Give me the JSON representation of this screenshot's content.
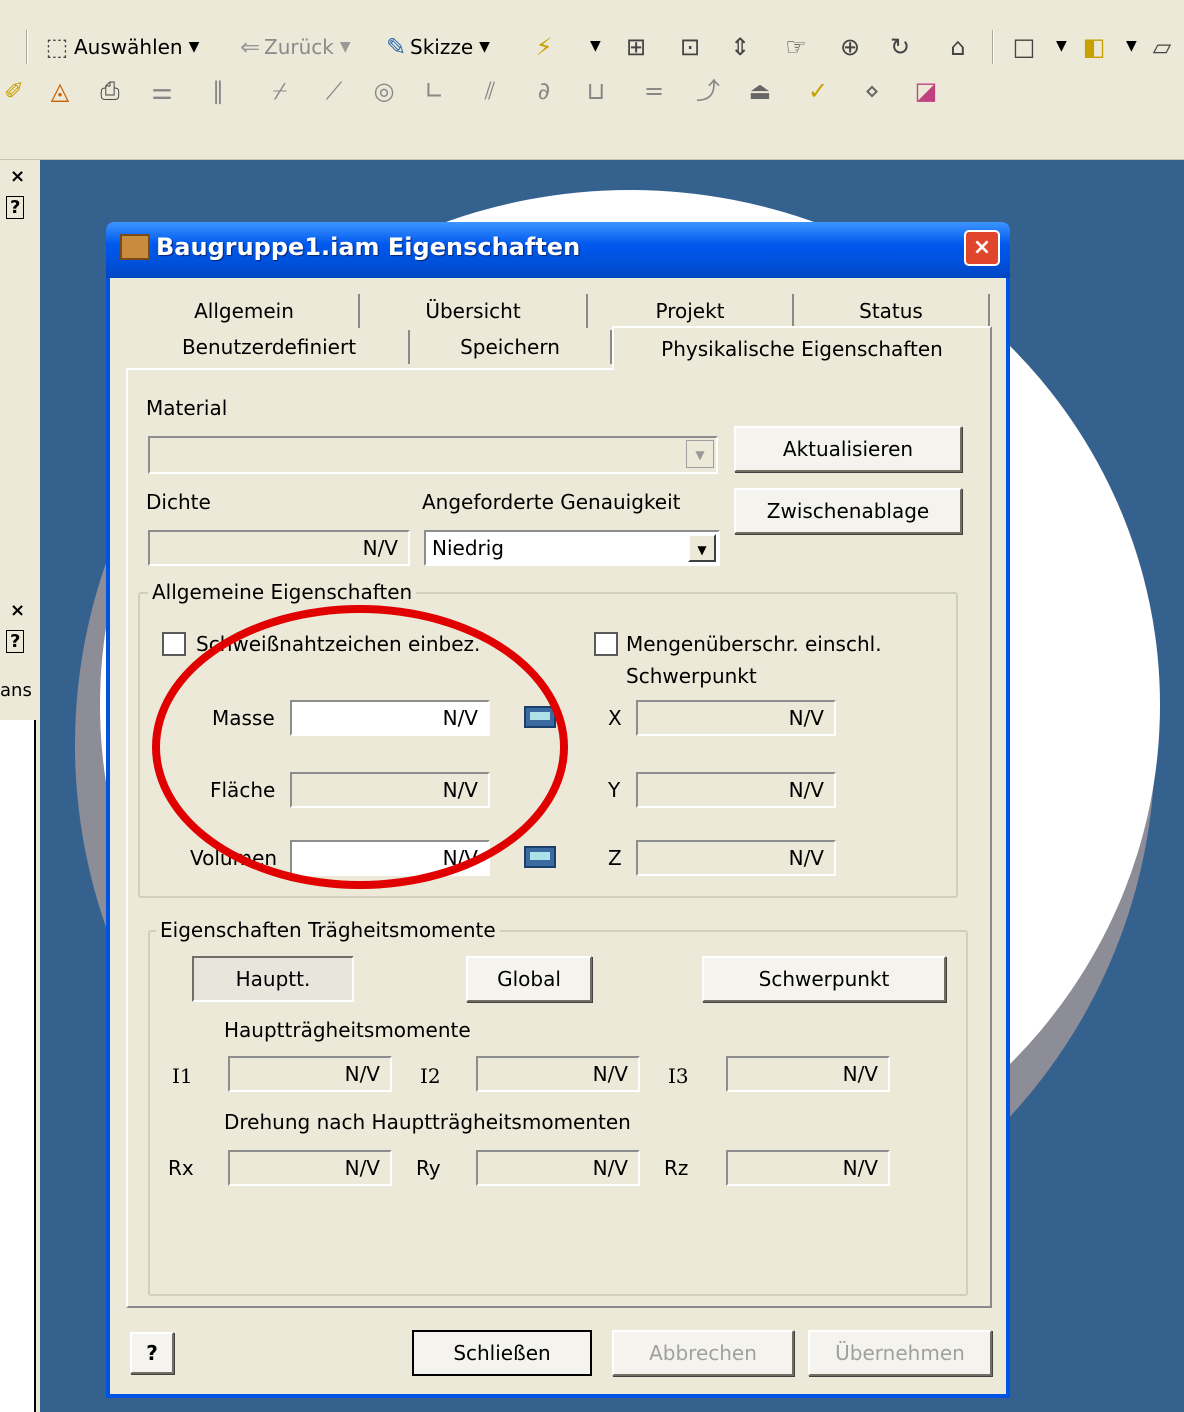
{
  "toolbar1": {
    "auswaehlen": "Auswählen",
    "zurueck": "Zurück",
    "skizze": "Skizze"
  },
  "left_panel": {
    "close": "×",
    "help": "?",
    "fragment": "ans"
  },
  "dialog": {
    "title": "Baugruppe1.iam Eigenschaften",
    "close": "×",
    "tabs": {
      "allgemein": "Allgemein",
      "uebersicht": "Übersicht",
      "projekt": "Projekt",
      "status": "Status",
      "benutzerdefiniert": "Benutzerdefiniert",
      "speichern": "Speichern",
      "physikalisch": "Physikalische Eigenschaften"
    },
    "material_label": "Material",
    "material_value": "",
    "aktualisieren": "Aktualisieren",
    "zwischenablage": "Zwischenablage",
    "dichte_label": "Dichte",
    "dichte_value": "N/V",
    "genauigkeit_label": "Angeforderte Genauigkeit",
    "genauigkeit_value": "Niedrig",
    "allgemeine": {
      "title": "Allgemeine Eigenschaften",
      "schweiss_check": "Schweißnahtzeichen einbez.",
      "menge_check": "Mengenüberschr. einschl.",
      "schwerpunkt_label": "Schwerpunkt",
      "masse_label": "Masse",
      "masse_value": "N/V",
      "flaeche_label": "Fläche",
      "flaeche_value": "N/V",
      "volumen_label": "Volumen",
      "volumen_value": "N/V",
      "x_label": "X",
      "x_value": "N/V",
      "y_label": "Y",
      "y_value": "N/V",
      "z_label": "Z",
      "z_value": "N/V"
    },
    "traegheit": {
      "title": "Eigenschaften Trägheitsmomente",
      "hauptt": "Hauptt.",
      "global": "Global",
      "schwerpunkt": "Schwerpunkt",
      "haupt_label": "Hauptträgheitsmomente",
      "i1_label": "I1",
      "i1_value": "N/V",
      "i2_label": "I2",
      "i2_value": "N/V",
      "i3_label": "I3",
      "i3_value": "N/V",
      "drehung_label": "Drehung nach Hauptträgheitsmomenten",
      "rx_label": "Rx",
      "rx_value": "N/V",
      "ry_label": "Ry",
      "ry_value": "N/V",
      "rz_label": "Rz",
      "rz_value": "N/V"
    },
    "footer": {
      "help": "?",
      "schliessen": "Schließen",
      "abbrechen": "Abbrechen",
      "uebernehmen": "Übernehmen"
    }
  },
  "colors": {
    "xp_title_blue": "#0058ee",
    "dialog_face": "#ece9d8",
    "viewport_blue": "#35618f",
    "annotation_red": "#e00000"
  },
  "icons": [
    "auswaehlen-icon",
    "zurueck-icon",
    "skizze-icon",
    "dropdown-arrow-icon",
    "close-icon",
    "help-icon",
    "calculator-icon"
  ]
}
